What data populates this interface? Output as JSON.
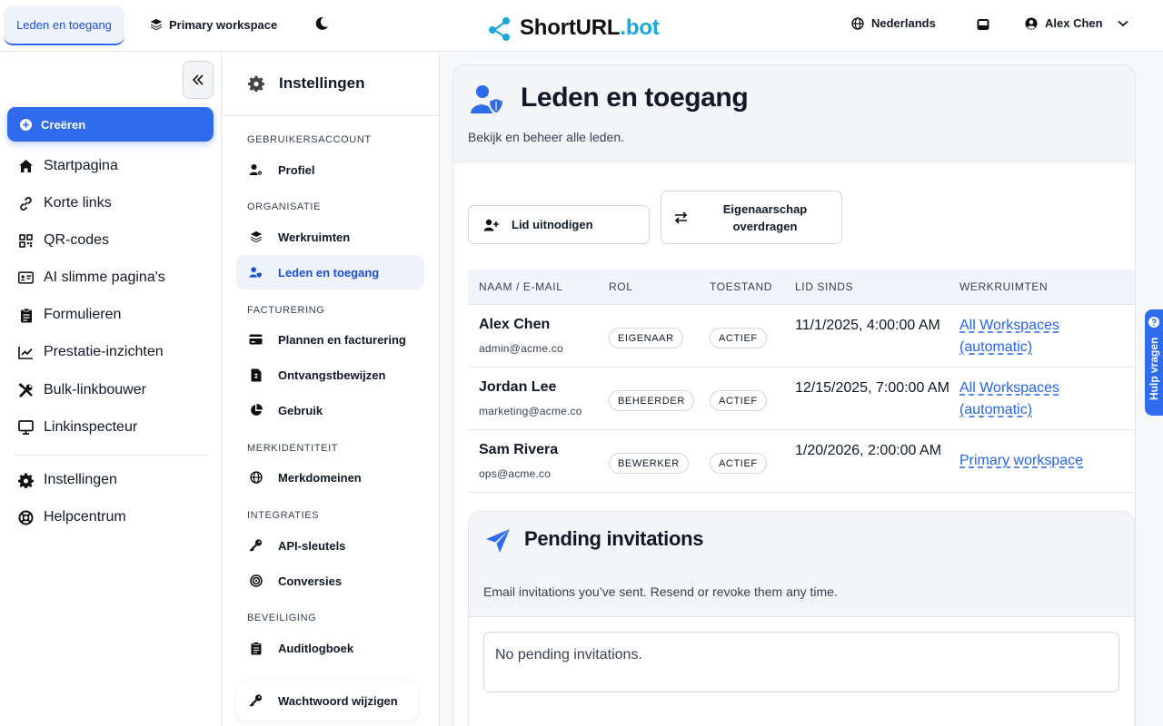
{
  "topbar": {
    "active_tab": "Leden en toegang",
    "workspace": "Primary workspace",
    "logo_main": "ShortURL",
    "logo_accent": ".bot",
    "language": "Nederlands",
    "user_name": "Alex Chen"
  },
  "sidebar": {
    "create_label": "Creëren",
    "items": [
      {
        "label": "Startpagina",
        "icon": "home-icon"
      },
      {
        "label": "Korte links",
        "icon": "link-icon"
      },
      {
        "label": "QR-codes",
        "icon": "qr-icon"
      },
      {
        "label": "AI slimme pagina's",
        "icon": "id-card-icon"
      },
      {
        "label": "Formulieren",
        "icon": "clipboard-icon"
      },
      {
        "label": "Prestatie-inzichten",
        "icon": "chart-line-icon"
      },
      {
        "label": "Bulk-linkbouwer",
        "icon": "tools-icon"
      },
      {
        "label": "Linkinspecteur",
        "icon": "monitor-icon"
      }
    ],
    "bottom_items": [
      {
        "label": "Instellingen",
        "icon": "gear-icon"
      },
      {
        "label": "Helpcentrum",
        "icon": "lifebuoy-icon"
      }
    ]
  },
  "settings": {
    "title": "Instellingen",
    "sections": {
      "account": "GEBRUIKERSACCOUNT",
      "organisation": "ORGANISATIE",
      "billing": "FACTURERING",
      "brand": "MERKIDENTITEIT",
      "integrations": "INTEGRATIES",
      "security": "BEVEILIGING"
    },
    "items": {
      "profile": "Profiel",
      "workspaces": "Werkruimten",
      "members": "Leden en toegang",
      "plans": "Plannen en facturering",
      "receipts": "Ontvangstbewijzen",
      "usage": "Gebruik",
      "domains": "Merkdomeinen",
      "api_keys": "API-sleutels",
      "conversions": "Conversies",
      "audit_log": "Auditlogboek"
    },
    "change_password": "Wachtwoord wijzigen"
  },
  "main": {
    "title": "Leden en toegang",
    "subtitle": "Bekijk en beheer alle leden.",
    "invite_button": "Lid uitnodigen",
    "transfer_button": "Eigenaarschap overdragen",
    "table": {
      "headers": [
        "NAAM / E-MAIL",
        "ROL",
        "TOESTAND",
        "LID SINDS",
        "WERKRUIMTEN"
      ],
      "rows": [
        {
          "name": "Alex Chen",
          "email": "admin@acme.co",
          "role": "EIGENAAR",
          "status": "ACTIEF",
          "since": "11/1/2025, 4:00:00 AM",
          "workspaces": "All Workspaces (automatic)"
        },
        {
          "name": "Jordan Lee",
          "email": "marketing@acme.co",
          "role": "BEHEERDER",
          "status": "ACTIEF",
          "since": "12/15/2025, 7:00:00 AM",
          "workspaces": "All Workspaces (automatic)"
        },
        {
          "name": "Sam Rivera",
          "email": "ops@acme.co",
          "role": "BEWERKER",
          "status": "ACTIEF",
          "since": "1/20/2026, 2:00:00 AM",
          "workspaces": "Primary workspace"
        }
      ]
    },
    "pending": {
      "title": "Pending invitations",
      "subtitle": "Email invitations you’ve sent. Resend or revoke them any time.",
      "empty": "No pending invitations."
    }
  },
  "help_tab": "Hulp vragen",
  "colors": {
    "accent": "#2f6bed",
    "logo_accent": "#1aa7e0",
    "link": "#2563eb"
  }
}
